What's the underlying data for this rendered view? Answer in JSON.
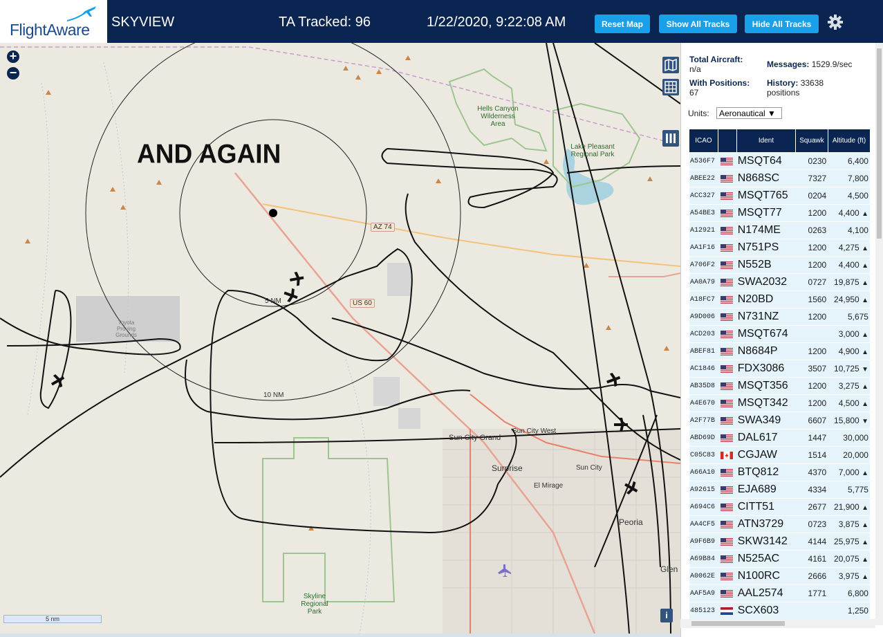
{
  "header": {
    "logo_text": "FlightAware",
    "app_name": "SKYVIEW",
    "tracked": "TA Tracked: 96",
    "datetime": "1/22/2020, 9:22:08 AM",
    "buttons": {
      "reset": "Reset Map",
      "show": "Show All Tracks",
      "hide": "Hide All Tracks"
    }
  },
  "map": {
    "annotation": "AND AGAIN",
    "ring_labels": {
      "inner": "5 NM",
      "outer": "10 NM"
    },
    "scale": "5 nm",
    "labels": {
      "hells_canyon": "Hells Canyon Wilderness Area",
      "lake_pleasant": "Lake Pleasant Regional Park",
      "skyline": "Skyline Regional Park",
      "toyota": "Toyota Proving Grounds"
    },
    "towns": {
      "sun_city_grand": "Sun City Grand",
      "sun_city_west": "Sun City West",
      "surprise": "Surprise",
      "sun_city": "Sun City",
      "el_mirage": "El Mirage",
      "peoria": "Peoria",
      "glendale": "Glen"
    },
    "roads": {
      "az74": "AZ 74",
      "us60": "US 60"
    },
    "zoom_in": "+",
    "zoom_out": "−",
    "info": "i"
  },
  "sidebar": {
    "total_aircraft_label": "Total Aircraft:",
    "total_aircraft_value": "n/a",
    "with_positions_label": "With Positions:",
    "with_positions_value": "67",
    "messages_label": "Messages:",
    "messages_value": "1529.9/sec",
    "history_label": "History:",
    "history_value": "33638 positions",
    "units_label": "Units:",
    "units_value": "Aeronautical ▼",
    "columns": [
      "ICAO",
      "",
      "Ident",
      "Squawk",
      "Altitude (ft)"
    ],
    "rows": [
      {
        "icao": "A536F7",
        "flag": "us",
        "ident": "MSQT64",
        "squawk": "0230",
        "alt": "6,400",
        "trend": ""
      },
      {
        "icao": "ABEE22",
        "flag": "us",
        "ident": "N868SC",
        "squawk": "7327",
        "alt": "7,800",
        "trend": ""
      },
      {
        "icao": "ACC327",
        "flag": "us",
        "ident": "MSQT765",
        "squawk": "0204",
        "alt": "4,500",
        "trend": ""
      },
      {
        "icao": "A54BE3",
        "flag": "us",
        "ident": "MSQT77",
        "squawk": "1200",
        "alt": "4,400",
        "trend": "▲"
      },
      {
        "icao": "A12921",
        "flag": "us",
        "ident": "N174ME",
        "squawk": "0263",
        "alt": "4,100",
        "trend": ""
      },
      {
        "icao": "AA1F16",
        "flag": "us",
        "ident": "N751PS",
        "squawk": "1200",
        "alt": "4,275",
        "trend": "▲"
      },
      {
        "icao": "A706F2",
        "flag": "us",
        "ident": "N552B",
        "squawk": "1200",
        "alt": "4,400",
        "trend": "▲"
      },
      {
        "icao": "AA0A79",
        "flag": "us",
        "ident": "SWA2032",
        "squawk": "0727",
        "alt": "19,875",
        "trend": "▲"
      },
      {
        "icao": "A18FC7",
        "flag": "us",
        "ident": "N20BD",
        "squawk": "1560",
        "alt": "24,950",
        "trend": "▲"
      },
      {
        "icao": "A9D006",
        "flag": "us",
        "ident": "N731NZ",
        "squawk": "1200",
        "alt": "5,675",
        "trend": ""
      },
      {
        "icao": "ACD203",
        "flag": "us",
        "ident": "MSQT674",
        "squawk": "",
        "alt": "3,000",
        "trend": "▲"
      },
      {
        "icao": "ABEF81",
        "flag": "us",
        "ident": "N8684P",
        "squawk": "1200",
        "alt": "4,900",
        "trend": "▲"
      },
      {
        "icao": "AC1846",
        "flag": "us",
        "ident": "FDX3086",
        "squawk": "3507",
        "alt": "10,725",
        "trend": "▼"
      },
      {
        "icao": "AB35D8",
        "flag": "us",
        "ident": "MSQT356",
        "squawk": "1200",
        "alt": "3,275",
        "trend": "▲"
      },
      {
        "icao": "A4E670",
        "flag": "us",
        "ident": "MSQT342",
        "squawk": "1200",
        "alt": "4,500",
        "trend": "▲"
      },
      {
        "icao": "A2F77B",
        "flag": "us",
        "ident": "SWA349",
        "squawk": "6607",
        "alt": "15,800",
        "trend": "▼"
      },
      {
        "icao": "ABD69D",
        "flag": "us",
        "ident": "DAL617",
        "squawk": "1447",
        "alt": "30,000",
        "trend": ""
      },
      {
        "icao": "C05C83",
        "flag": "ca",
        "ident": "CGJAW",
        "squawk": "1514",
        "alt": "20,000",
        "trend": ""
      },
      {
        "icao": "A66A10",
        "flag": "us",
        "ident": "BTQ812",
        "squawk": "4370",
        "alt": "7,000",
        "trend": "▲"
      },
      {
        "icao": "A92615",
        "flag": "us",
        "ident": "EJA689",
        "squawk": "4334",
        "alt": "5,775",
        "trend": ""
      },
      {
        "icao": "A694C6",
        "flag": "us",
        "ident": "CITT51",
        "squawk": "2677",
        "alt": "21,900",
        "trend": "▲"
      },
      {
        "icao": "AA4CF5",
        "flag": "us",
        "ident": "ATN3729",
        "squawk": "0723",
        "alt": "3,875",
        "trend": "▲"
      },
      {
        "icao": "A9F6B9",
        "flag": "us",
        "ident": "SKW3142",
        "squawk": "4144",
        "alt": "25,975",
        "trend": "▲"
      },
      {
        "icao": "A69B84",
        "flag": "us",
        "ident": "N525AC",
        "squawk": "4161",
        "alt": "20,075",
        "trend": "▲"
      },
      {
        "icao": "A0062E",
        "flag": "us",
        "ident": "N100RC",
        "squawk": "2666",
        "alt": "3,975",
        "trend": "▲"
      },
      {
        "icao": "AAF5A9",
        "flag": "us",
        "ident": "AAL2574",
        "squawk": "1771",
        "alt": "6,800",
        "trend": ""
      },
      {
        "icao": "485123",
        "flag": "nl",
        "ident": "SCX603",
        "squawk": "",
        "alt": "1,250",
        "trend": ""
      }
    ]
  }
}
